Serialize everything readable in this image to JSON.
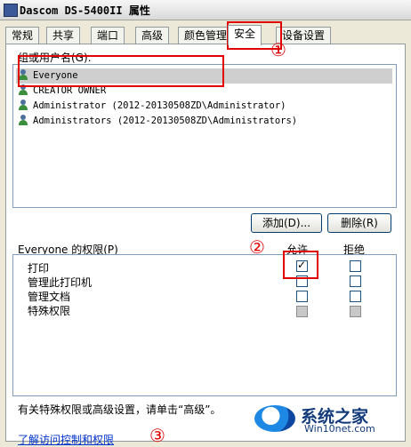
{
  "window": {
    "title": "Dascom DS-5400II 属性"
  },
  "tabs": [
    {
      "label": "常规"
    },
    {
      "label": "共享"
    },
    {
      "label": "端口"
    },
    {
      "label": "高级"
    },
    {
      "label": "颜色管理"
    },
    {
      "label": "安全"
    },
    {
      "label": "设备设置"
    }
  ],
  "active_tab": "安全",
  "groups": {
    "label": "组或用户名(G):",
    "items": [
      {
        "name": "Everyone",
        "selected": true
      },
      {
        "name": "CREATOR OWNER"
      },
      {
        "name": "Administrator (2012-20130508ZD\\Administrator)"
      },
      {
        "name": "Administrators (2012-20130508ZD\\Administrators)"
      }
    ],
    "add_label": "添加(D)...",
    "remove_label": "删除(R)"
  },
  "permissions": {
    "label": "Everyone 的权限(P)",
    "allow_header": "允许",
    "deny_header": "拒绝",
    "rows": [
      {
        "name": "打印",
        "allow": true,
        "deny": false
      },
      {
        "name": "管理此打印机",
        "allow": false,
        "deny": false
      },
      {
        "name": "管理文档",
        "allow": false,
        "deny": false
      },
      {
        "name": "特殊权限",
        "allow": false,
        "deny": false,
        "disabled": true
      }
    ]
  },
  "advanced_note": "有关特殊权限或高级设置，请单击“高级”。",
  "help_link": "了解访问控制和权限",
  "annotations": {
    "one": "①",
    "two": "②",
    "three": "③"
  },
  "watermark": {
    "text": "系统之家",
    "sub": "Win10net.com"
  }
}
